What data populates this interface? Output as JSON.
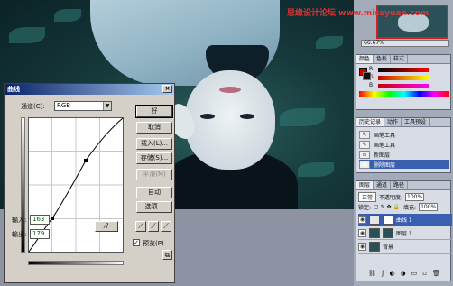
{
  "watermark": "思缘设计论坛 www.missyuan.com",
  "navigator": {
    "zoom": "66.67%"
  },
  "color_panel": {
    "tabs": [
      "颜色",
      "色板",
      "样式"
    ],
    "channels": [
      {
        "label": "R",
        "value": ""
      },
      {
        "label": "G",
        "value": ""
      },
      {
        "label": "B",
        "value": ""
      }
    ],
    "foreground": "#cc0000",
    "background": "#111111"
  },
  "history_panel": {
    "tabs": [
      "历史记录",
      "动作",
      "工具预设"
    ],
    "items": [
      {
        "label": "画笔工具"
      },
      {
        "label": "画笔工具"
      },
      {
        "label": "新图层"
      },
      {
        "label": "删除图层",
        "selected": true
      }
    ]
  },
  "layers_panel": {
    "tabs": [
      "图层",
      "通道",
      "路径"
    ],
    "blend_mode": "正常",
    "opacity_label": "不透明度:",
    "opacity": "100%",
    "fill_label": "填充:",
    "fill": "100%",
    "lock_label": "锁定:",
    "layers": [
      {
        "name": "曲线 1",
        "selected": true
      },
      {
        "name": "图层 1"
      },
      {
        "name": "背景"
      }
    ]
  },
  "curves_dialog": {
    "title": "曲线",
    "channel_label": "通道(C):",
    "channel_value": "RGB",
    "buttons": {
      "ok": "好",
      "cancel": "取消",
      "load": "载入(L)...",
      "save": "存储(S)...",
      "smooth": "平滑(M)",
      "auto": "自动",
      "options": "选项..."
    },
    "input_label": "输入:",
    "input_value": "163",
    "output_label": "输出:",
    "output_value": "179",
    "preview_label": "预览(P)",
    "preview_checked": true
  }
}
